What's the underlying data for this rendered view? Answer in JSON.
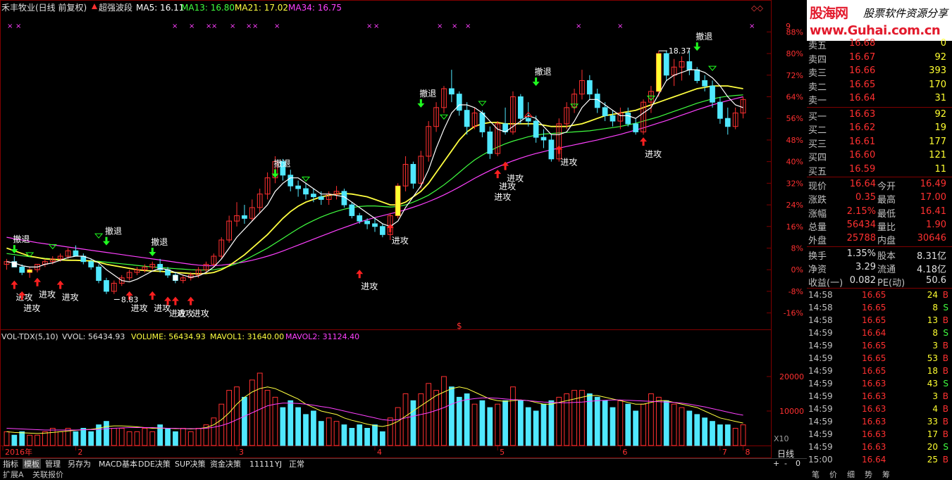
{
  "header": {
    "stock": "禾丰牧业(日线 前复权)",
    "indicator": "超强波段",
    "ma5": "MA5: 16.11",
    "ma13": "MA13: 16.80",
    "ma21": "MA21: 17.02",
    "ma34": "MA34: 16.75"
  },
  "colors": {
    "up": "#ff3030",
    "down": "#50e8ff",
    "ma5": "#ffffff",
    "ma13": "#ffff40",
    "ma21": "#40ff40",
    "ma34": "#ff40ff",
    "grid": "#800000"
  },
  "price_axis": {
    "min": -16,
    "max": 88,
    "ticks": [
      "88%",
      "80%",
      "72%",
      "64%",
      "56%",
      "48%",
      "40%",
      "32%",
      "24%",
      "16%",
      "8%",
      "0%",
      "-8%",
      "-16%"
    ],
    "extra_tick": "9"
  },
  "vol_header": {
    "name": "VOL-TDX(5,10)",
    "vvol": "VVOL: 56434.93",
    "volume": "VOLUME: 56434.93",
    "mavol1": "MAVOL1: 31640.00",
    "mavol2": "MAVOL2: 31124.40"
  },
  "vol_axis": {
    "ticks": [
      "20000",
      "10000"
    ],
    "unit": "X10"
  },
  "chart_data": {
    "type": "candlestick",
    "y_unit": "%",
    "base_price": 8.44,
    "ohlc": [
      [
        2,
        4,
        0,
        3
      ],
      [
        3,
        5,
        1,
        1
      ],
      [
        1,
        2,
        -2,
        -1
      ],
      [
        -1,
        1,
        -3,
        0
      ],
      [
        0,
        2,
        -1,
        2
      ],
      [
        2,
        4,
        1,
        3
      ],
      [
        3,
        5,
        2,
        4
      ],
      [
        4,
        6,
        3,
        5
      ],
      [
        5,
        8,
        4,
        7
      ],
      [
        7,
        9,
        5,
        5
      ],
      [
        5,
        6,
        2,
        3
      ],
      [
        3,
        4,
        0,
        1
      ],
      [
        1,
        2,
        -5,
        -4
      ],
      [
        -4,
        -3,
        -9,
        -8
      ],
      [
        -8,
        -4,
        -9,
        -5
      ],
      [
        -5,
        -2,
        -6,
        -3
      ],
      [
        -3,
        0,
        -4,
        -1
      ],
      [
        -1,
        1,
        -2,
        0
      ],
      [
        0,
        2,
        -1,
        1
      ],
      [
        1,
        3,
        0,
        2
      ],
      [
        2,
        4,
        -1,
        0
      ],
      [
        0,
        1,
        -3,
        -2
      ],
      [
        -2,
        -1,
        -5,
        -4
      ],
      [
        -4,
        -2,
        -5,
        -3
      ],
      [
        -3,
        -1,
        -4,
        -2
      ],
      [
        -2,
        1,
        -3,
        0
      ],
      [
        0,
        3,
        -1,
        2
      ],
      [
        2,
        6,
        1,
        5
      ],
      [
        5,
        12,
        4,
        11
      ],
      [
        11,
        20,
        10,
        18
      ],
      [
        18,
        25,
        16,
        20
      ],
      [
        20,
        24,
        17,
        19
      ],
      [
        19,
        26,
        18,
        23
      ],
      [
        23,
        30,
        21,
        28
      ],
      [
        28,
        36,
        26,
        34
      ],
      [
        34,
        42,
        32,
        40
      ],
      [
        40,
        41,
        33,
        35
      ],
      [
        35,
        37,
        29,
        31
      ],
      [
        31,
        33,
        27,
        30
      ],
      [
        30,
        32,
        26,
        28
      ],
      [
        28,
        30,
        25,
        27
      ],
      [
        27,
        29,
        24,
        26
      ],
      [
        26,
        29,
        24,
        28
      ],
      [
        28,
        31,
        26,
        29
      ],
      [
        29,
        30,
        23,
        24
      ],
      [
        24,
        25,
        19,
        20
      ],
      [
        20,
        21,
        17,
        18
      ],
      [
        18,
        19,
        15,
        17
      ],
      [
        17,
        19,
        14,
        16
      ],
      [
        16,
        17,
        12,
        13
      ],
      [
        13,
        21,
        11,
        20
      ],
      [
        20,
        32,
        19,
        31
      ],
      [
        31,
        42,
        29,
        39
      ],
      [
        39,
        40,
        30,
        32
      ],
      [
        32,
        44,
        30,
        42
      ],
      [
        42,
        55,
        40,
        53
      ],
      [
        53,
        62,
        51,
        60
      ],
      [
        60,
        68,
        58,
        67
      ],
      [
        67,
        74,
        62,
        65
      ],
      [
        65,
        66,
        57,
        59
      ],
      [
        59,
        62,
        50,
        53
      ],
      [
        53,
        60,
        52,
        58
      ],
      [
        58,
        59,
        49,
        51
      ],
      [
        51,
        53,
        41,
        43
      ],
      [
        43,
        55,
        42,
        54
      ],
      [
        54,
        60,
        50,
        51
      ],
      [
        51,
        66,
        50,
        64
      ],
      [
        64,
        65,
        54,
        56
      ],
      [
        56,
        62,
        53,
        55
      ],
      [
        55,
        57,
        47,
        49
      ],
      [
        49,
        52,
        45,
        48
      ],
      [
        48,
        50,
        40,
        41
      ],
      [
        41,
        56,
        40,
        54
      ],
      [
        54,
        62,
        52,
        60
      ],
      [
        60,
        67,
        58,
        65
      ],
      [
        65,
        74,
        63,
        70
      ],
      [
        70,
        72,
        63,
        65
      ],
      [
        65,
        67,
        58,
        60
      ],
      [
        60,
        62,
        55,
        57
      ],
      [
        57,
        59,
        53,
        55
      ],
      [
        55,
        60,
        52,
        58
      ],
      [
        58,
        60,
        53,
        54
      ],
      [
        54,
        56,
        50,
        51
      ],
      [
        51,
        63,
        50,
        62
      ],
      [
        62,
        68,
        58,
        66
      ],
      [
        66,
        81,
        64,
        80
      ],
      [
        80,
        81,
        70,
        72
      ],
      [
        72,
        78,
        68,
        75
      ],
      [
        75,
        79,
        70,
        77
      ],
      [
        77,
        81,
        72,
        74
      ],
      [
        74,
        75,
        69,
        70
      ],
      [
        70,
        72,
        66,
        68
      ],
      [
        68,
        70,
        60,
        62
      ],
      [
        62,
        64,
        54,
        56
      ],
      [
        56,
        60,
        50,
        53
      ],
      [
        53,
        60,
        52,
        58
      ],
      [
        58,
        64,
        56,
        63
      ]
    ],
    "ma5": [
      3,
      2.5,
      1.5,
      1,
      1,
      2,
      2.5,
      3.5,
      4.5,
      5,
      5,
      4,
      2.5,
      0,
      -2,
      -4,
      -4.5,
      -3.5,
      -2,
      -0.5,
      0.5,
      0,
      -1,
      -2,
      -2.8,
      -2.3,
      -1,
      1,
      4,
      8,
      12,
      15,
      18,
      21,
      24,
      29,
      32,
      34,
      34,
      32,
      30,
      28,
      28,
      27.5,
      27,
      25,
      23,
      21,
      19,
      17,
      16,
      18,
      23,
      27,
      31,
      37,
      45,
      52,
      58,
      61,
      61,
      60,
      58,
      55,
      52,
      51,
      53,
      55,
      57,
      56,
      53,
      50,
      50,
      51,
      55,
      60,
      63,
      63,
      61,
      59,
      57,
      57,
      56,
      58,
      60,
      65,
      70,
      72,
      73,
      74,
      74,
      73,
      71,
      68,
      64,
      61,
      60
    ],
    "ma13": [
      8,
      7,
      6,
      5,
      4.5,
      4,
      3.8,
      3.6,
      3.5,
      3.5,
      3.4,
      3.2,
      2.8,
      2,
      1.5,
      1,
      0.5,
      0,
      -0.3,
      -0.5,
      -0.6,
      -0.8,
      -1,
      -1.2,
      -1.4,
      -1.5,
      -1.4,
      -1,
      0,
      1.5,
      3.5,
      5.5,
      8,
      10.5,
      13,
      16,
      19,
      21.5,
      23.5,
      25,
      26,
      27,
      27.5,
      28,
      28.2,
      28,
      27.5,
      27,
      26,
      25,
      24,
      24,
      25,
      27,
      29,
      32,
      36,
      40,
      44,
      48,
      51,
      53,
      54,
      54.5,
      54.5,
      54,
      54,
      54,
      54,
      54,
      53.5,
      53,
      53,
      53,
      53.5,
      54,
      55,
      56,
      57,
      57.5,
      58,
      58.5,
      59,
      60,
      61,
      62,
      63,
      64,
      65,
      66,
      67,
      67.5,
      68,
      68,
      68,
      67.5,
      67
    ],
    "ma21": [
      6,
      5.6,
      5.2,
      4.8,
      4.5,
      4.2,
      4,
      3.8,
      3.6,
      3.5,
      3.4,
      3.3,
      3.1,
      2.8,
      2.5,
      2.2,
      1.9,
      1.6,
      1.3,
      1,
      0.8,
      0.6,
      0.4,
      0.2,
      0,
      -0.1,
      -0.1,
      0,
      0.5,
      1.3,
      2.3,
      3.5,
      5,
      6.5,
      8,
      9.8,
      11.6,
      13.4,
      15.2,
      16.8,
      18.2,
      19.5,
      20.6,
      21.6,
      22.4,
      23,
      23.4,
      23.6,
      23.6,
      23.4,
      23.2,
      23.4,
      24,
      25,
      26.2,
      27.6,
      29.4,
      31.4,
      33.6,
      36,
      38.4,
      40.6,
      42.4,
      44,
      45.4,
      46.6,
      47.6,
      48.4,
      49.2,
      49.8,
      50.2,
      50.4,
      50.6,
      50.8,
      51,
      51.2,
      51.4,
      51.8,
      52.2,
      52.6,
      53,
      53.6,
      54.2,
      55,
      55.8,
      56.6,
      57.6,
      58.6,
      59.6,
      60.6,
      61.6,
      62.4,
      63.2,
      63.8,
      64.2,
      64.5,
      64.7
    ],
    "ma34": [
      12,
      11.5,
      11,
      10.5,
      10,
      9.6,
      9.2,
      8.8,
      8.4,
      8,
      7.6,
      7.2,
      6.8,
      6.4,
      6,
      5.6,
      5.2,
      4.8,
      4.4,
      4,
      3.6,
      3.2,
      2.8,
      2.4,
      2,
      1.7,
      1.5,
      1.5,
      1.7,
      2,
      2.4,
      2.9,
      3.5,
      4.2,
      5,
      5.9,
      6.9,
      8,
      9.1,
      10.2,
      11.3,
      12.4,
      13.5,
      14.6,
      15.6,
      16.6,
      17.6,
      18.5,
      19.3,
      20,
      20.7,
      21.4,
      22.2,
      23.1,
      24.1,
      25.2,
      26.4,
      27.7,
      29.1,
      30.6,
      32.2,
      33.8,
      35.3,
      36.7,
      38,
      39.2,
      40.3,
      41.3,
      42.2,
      43,
      43.7,
      44.4,
      45,
      45.6,
      46.2,
      46.8,
      47.4,
      48,
      48.7,
      49.4,
      50.1,
      50.9,
      51.7,
      52.5,
      53.4,
      54.3,
      55.2,
      56.2,
      57.2,
      58.2,
      59.2,
      60.1,
      61,
      61.8,
      62.6,
      63.3,
      64
    ],
    "volume": [
      4,
      3,
      4,
      3,
      3,
      4,
      5,
      4,
      5,
      4,
      5,
      4,
      6,
      7,
      5,
      5,
      4,
      4,
      5,
      4,
      6,
      5,
      4,
      5,
      4,
      5,
      6,
      8,
      12,
      16,
      17,
      14,
      19,
      21,
      16,
      14,
      11,
      13,
      11,
      9,
      10,
      7,
      8,
      7,
      6,
      5,
      6,
      5,
      6,
      4,
      8,
      11,
      15,
      13,
      15,
      18,
      16,
      20,
      17,
      14,
      15,
      12,
      13,
      11,
      12,
      13,
      17,
      13,
      11,
      10,
      12,
      13,
      14,
      15,
      16,
      16,
      15,
      14,
      13,
      11,
      13,
      12,
      10,
      12,
      15,
      14,
      13,
      12,
      11,
      10,
      9,
      8,
      7,
      6,
      6,
      5,
      6
    ],
    "mavol1": [
      4,
      3.8,
      3.7,
      3.6,
      3.5,
      3.6,
      3.8,
      4,
      4.2,
      4.4,
      4.6,
      4.7,
      5,
      5.5,
      5.7,
      5.7,
      5.6,
      5.4,
      5.2,
      5,
      5,
      5,
      4.9,
      4.9,
      4.8,
      4.9,
      5.2,
      6,
      7.5,
      9.5,
      12,
      14,
      15.5,
      16.5,
      17,
      16.5,
      15.5,
      14.5,
      13.5,
      12,
      11,
      10,
      9.5,
      9,
      8,
      7.3,
      6.8,
      6.2,
      5.8,
      5.5,
      6,
      7,
      8.5,
      10,
      11.5,
      13,
      14.5,
      15.5,
      16.5,
      17,
      16.5,
      15.5,
      14.5,
      13.5,
      13,
      12.8,
      13,
      13.2,
      13,
      12.5,
      12,
      12,
      12.5,
      13,
      13.5,
      14,
      14.5,
      14.5,
      14,
      13.5,
      13,
      12.5,
      12,
      12,
      12.5,
      13,
      13,
      12.5,
      12,
      11.5,
      11,
      10,
      9,
      8,
      7.5,
      7,
      6.5
    ],
    "mavol2": [
      5,
      4.9,
      4.8,
      4.7,
      4.6,
      4.5,
      4.5,
      4.5,
      4.5,
      4.5,
      4.6,
      4.6,
      4.7,
      4.9,
      5,
      5.1,
      5.2,
      5.2,
      5.2,
      5.2,
      5.1,
      5,
      5,
      4.9,
      4.9,
      4.9,
      5,
      5.3,
      5.8,
      6.5,
      7.5,
      8.5,
      9.5,
      10.5,
      11.5,
      12,
      12.3,
      12.3,
      12.2,
      12,
      11.7,
      11.3,
      11,
      10.5,
      10,
      9.5,
      9,
      8.5,
      8,
      7.5,
      7.3,
      7.5,
      8,
      8.5,
      9,
      9.5,
      10.2,
      11,
      12,
      12.8,
      13.3,
      13.6,
      13.8,
      13.8,
      13.7,
      13.5,
      13.3,
      13.2,
      13,
      12.8,
      12.6,
      12.5,
      12.4,
      12.4,
      12.5,
      12.6,
      12.8,
      13,
      13.1,
      13.2,
      13.2,
      13.1,
      13,
      12.9,
      12.8,
      12.7,
      12.6,
      12.5,
      12.3,
      12,
      11.6,
      11.2,
      10.7,
      10.2,
      9.7,
      9.2,
      8.8
    ],
    "x_labels": [
      {
        "i": 0,
        "t": "2016年"
      },
      {
        "i": 9,
        "t": "2"
      },
      {
        "i": 30,
        "t": "3"
      },
      {
        "i": 48,
        "t": "4"
      },
      {
        "i": 64,
        "t": "5"
      },
      {
        "i": 80,
        "t": "6"
      },
      {
        "i": 93,
        "t": "7"
      },
      {
        "i": 96,
        "t": "8"
      }
    ]
  },
  "annotations": {
    "retreat": "撤退",
    "attack": "进攻",
    "high_label": "18.37",
    "low_label": "8.83",
    "dollar": "$"
  },
  "panel": {
    "logo_main_a": "股海网",
    "logo_slogan": "股票软件资源分享",
    "logo_url": "www.Guhai.com.cn",
    "asks": [
      {
        "label": "卖五",
        "price": "16.68",
        "vol": "0"
      },
      {
        "label": "卖四",
        "price": "16.67",
        "vol": "92"
      },
      {
        "label": "卖三",
        "price": "16.66",
        "vol": "393"
      },
      {
        "label": "卖二",
        "price": "16.65",
        "vol": "170"
      },
      {
        "label": "卖一",
        "price": "16.64",
        "vol": "31"
      }
    ],
    "bids": [
      {
        "label": "买一",
        "price": "16.63",
        "vol": "92"
      },
      {
        "label": "买二",
        "price": "16.62",
        "vol": "19"
      },
      {
        "label": "买三",
        "price": "16.61",
        "vol": "177"
      },
      {
        "label": "买四",
        "price": "16.60",
        "vol": "121"
      },
      {
        "label": "买五",
        "price": "16.59",
        "vol": "11"
      }
    ],
    "stats": [
      {
        "l1": "现价",
        "v1": "16.64",
        "l2": "今开",
        "v2": "16.49"
      },
      {
        "l1": "涨跌",
        "v1": "0.35",
        "l2": "最高",
        "v2": "17.00"
      },
      {
        "l1": "涨幅",
        "v1": "2.15%",
        "l2": "最低",
        "v2": "16.41"
      },
      {
        "l1": "总量",
        "v1": "56434",
        "l2": "量比",
        "v2": "1.90"
      },
      {
        "l1": "外盘",
        "v1": "25788",
        "l2": "内盘",
        "v2": "30646"
      }
    ],
    "stats2": [
      {
        "l1": "换手",
        "v1": "1.35%",
        "l2": "股本",
        "v2": "8.31亿"
      },
      {
        "l1": "净资",
        "v1": "3.29",
        "l2": "流通",
        "v2": "4.18亿"
      },
      {
        "l1": "收益(一)",
        "v1": "0.082",
        "l2": "PE(动)",
        "v2": "50.6"
      }
    ],
    "ticks": [
      {
        "t": "14:58",
        "p": "16.65",
        "v": "24",
        "s": "B"
      },
      {
        "t": "14:58",
        "p": "16.65",
        "v": "8",
        "s": "S"
      },
      {
        "t": "14:58",
        "p": "16.65",
        "v": "13",
        "s": "B"
      },
      {
        "t": "14:59",
        "p": "16.64",
        "v": "8",
        "s": "S"
      },
      {
        "t": "14:59",
        "p": "16.65",
        "v": "3",
        "s": "B"
      },
      {
        "t": "14:59",
        "p": "16.65",
        "v": "53",
        "s": "B"
      },
      {
        "t": "14:59",
        "p": "16.65",
        "v": "18",
        "s": "B"
      },
      {
        "t": "14:59",
        "p": "16.63",
        "v": "43",
        "s": "S"
      },
      {
        "t": "14:59",
        "p": "16.63",
        "v": "3",
        "s": "B"
      },
      {
        "t": "14:59",
        "p": "16.63",
        "v": "4",
        "s": "B"
      },
      {
        "t": "14:59",
        "p": "16.63",
        "v": "33",
        "s": "B"
      },
      {
        "t": "14:59",
        "p": "16.63",
        "v": "17",
        "s": "B"
      },
      {
        "t": "14:59",
        "p": "16.63",
        "v": "20",
        "s": "S"
      },
      {
        "t": "15:00",
        "p": "16.64",
        "v": "25",
        "s": "B"
      }
    ],
    "tabs": [
      "笔",
      "价",
      "细",
      "势",
      "筹"
    ]
  },
  "toolbar": {
    "items": [
      "指标",
      "模板",
      "管理",
      "另存为",
      "MACD基本",
      "DDE决策",
      "SUP决策",
      "资金决策",
      "11111",
      "YJ",
      "正常"
    ],
    "selected": 1,
    "bottom": [
      "扩展A",
      "关联报价"
    ],
    "period": "日线",
    "zoom_plus": "+",
    "zoom_minus": "-",
    "zoom_zero": "0"
  }
}
